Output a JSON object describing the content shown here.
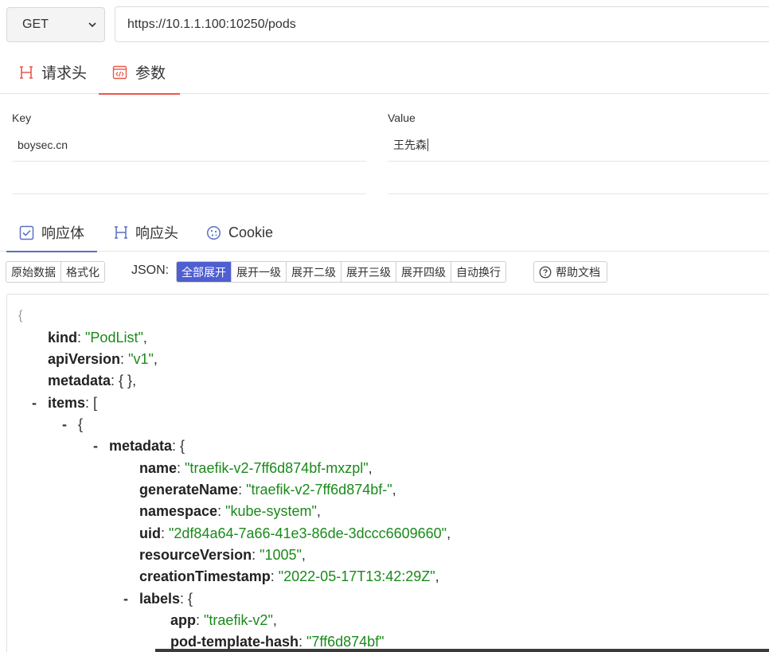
{
  "request": {
    "method": "GET",
    "url": "https://10.1.1.100:10250/pods"
  },
  "request_tabs": [
    {
      "label": "请求头",
      "icon": "heading-icon",
      "active": false
    },
    {
      "label": "参数",
      "icon": "code-icon",
      "active": true
    }
  ],
  "params": {
    "key_header": "Key",
    "value_header": "Value",
    "rows": [
      {
        "key": "boysec.cn",
        "value": "王先森"
      },
      {
        "key": "",
        "value": ""
      }
    ]
  },
  "response_tabs": [
    {
      "label": "响应体",
      "icon": "checkbox-icon",
      "active": true
    },
    {
      "label": "响应头",
      "icon": "heading-icon",
      "active": false
    },
    {
      "label": "Cookie",
      "icon": "cookie-icon",
      "active": false
    }
  ],
  "toolbar": {
    "view_buttons": [
      "原始数据",
      "格式化"
    ],
    "json_label": "JSON:",
    "expand_buttons": [
      "全部展开",
      "展开一级",
      "展开二级",
      "展开三级",
      "展开四级",
      "自动换行"
    ],
    "active_expand": "全部展开",
    "help_label": "帮助文档"
  },
  "json_lines": [
    {
      "brace": "{"
    },
    {
      "key": "kind",
      "value": "\"PodList\"",
      "tail": ","
    },
    {
      "key": "apiVersion",
      "value": "\"v1\"",
      "tail": ","
    },
    {
      "key": "metadata",
      "plain": "{ },"
    },
    {
      "dash": "-",
      "key": "items",
      "plain": "["
    },
    {
      "dash": "-",
      "plain": "{"
    },
    {
      "dash": "-",
      "key": "metadata",
      "plain": "{"
    },
    {
      "key": "name",
      "value": "\"traefik-v2-7ff6d874bf-mxzpl\"",
      "tail": ","
    },
    {
      "key": "generateName",
      "value": "\"traefik-v2-7ff6d874bf-\"",
      "tail": ","
    },
    {
      "key": "namespace",
      "value": "\"kube-system\"",
      "tail": ","
    },
    {
      "key": "uid",
      "value": "\"2df84a64-7a66-41e3-86de-3dccc6609660\"",
      "tail": ","
    },
    {
      "key": "resourceVersion",
      "value": "\"1005\"",
      "tail": ","
    },
    {
      "key": "creationTimestamp",
      "value": "\"2022-05-17T13:42:29Z\"",
      "tail": ","
    },
    {
      "dash": "-",
      "key": "labels",
      "plain": "{"
    },
    {
      "key": "app",
      "value": "\"traefik-v2\"",
      "tail": ","
    },
    {
      "key": "pod-template-hash",
      "value": "\"7ff6d874bf\"",
      "tail": ""
    }
  ],
  "colors": {
    "request_tab_accent": "#e9584a",
    "response_tab_accent": "#5a6fc9",
    "active_button": "#4f5fd0",
    "json_string": "#1a8a1a"
  }
}
